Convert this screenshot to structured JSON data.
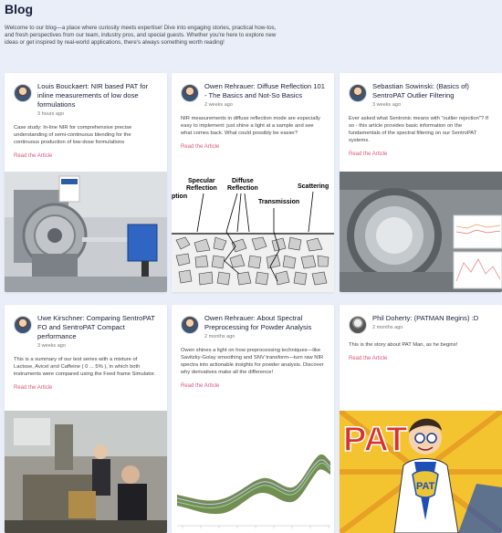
{
  "page": {
    "title": "Blog",
    "intro": "Welcome to our blog—a place where curiosity meets expertise! Dive into engaging stories, practical how-tos, and fresh perspectives from our team, industry pros, and special guests. Whether you're here to explore new ideas or get inspired by real-world applications, there's always something worth reading!"
  },
  "posts": [
    {
      "title": "Louis Bouckaert: NIR based PAT for inline measurements of low dose formulations",
      "date": "3 hours ago",
      "excerpt": "Case study: In-line NIR for comprehensive precise understanding of semi-continuous blending for the continuous production of low-dose formulations",
      "link": "Read the Article"
    },
    {
      "title": "Owen Rehrauer: Diffuse Reflection 101 - The Basics and Not-So Basics",
      "date": "2 weeks ago",
      "excerpt": "NIR measurements in diffuse reflection mode are especially easy to implement: just shine a light at a sample and see what comes back. What could possibly be easier?",
      "link": "Read the Article",
      "diagram": {
        "specular": "Specular",
        "reflection_1": "Reflection",
        "diffuse": "Diffuse",
        "reflection_2": "Reflection",
        "transmission": "Transmission",
        "scattering": "Scattering",
        "ption": "ption"
      }
    },
    {
      "title": "Sebastian Sowinski: (Basics of) SentroPAT Outlier Filtering",
      "date": "3 weeks ago",
      "excerpt": "Ever asked what Sentronic means with \"outlier rejection\"? If so - this article provides basic information on the fundamentals of the spectral filtering on our SentroPAT systems.",
      "link": "Read the Article"
    },
    {
      "title": "Uwe Kirschner: Comparing SentroPAT FO and SentroPAT Compact performance",
      "date": "3 weeks ago",
      "excerpt": "This is a summary of our test series with a mixture of Lactose, Avicel and Caffeine ( 0 ... 5% ), in which both instruments were compared using the Feed frame Simulator.",
      "link": "Read the Article"
    },
    {
      "title": "Owen Rehrauer: About Spectral Preprocessing for Powder Analysis",
      "date": "2 months ago",
      "excerpt": "Owen shines a light on how preprocessing techniques—like Savitzky-Golay smoothing and SNV transform—turn raw NIR spectra into actionable insights for powder analysis. Discover why derivatives make all the difference!",
      "link": "Read the Article"
    },
    {
      "title": "Phil Doherty: (PATMAN Begins) :D",
      "date": "2 months ago",
      "excerpt": "This is the story about PAT Man, as he begins!",
      "link": "Read the Article",
      "comic": {
        "big": "PAT",
        "badge": "PAT"
      }
    }
  ],
  "colors": {
    "background": "#e9eef8",
    "link": "#e0567a",
    "title": "#1a1f3a"
  }
}
